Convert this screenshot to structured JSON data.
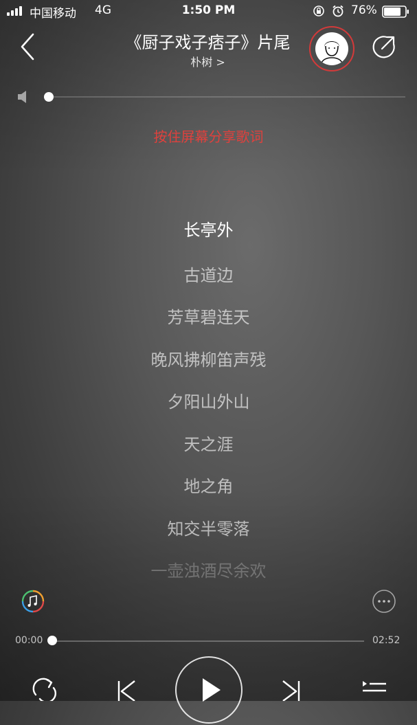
{
  "status_bar": {
    "carrier": "中国移动",
    "network": "4G",
    "time": "1:50 PM",
    "battery_pct": "76%"
  },
  "header": {
    "title": "《厨子戏子痞子》片尾",
    "artist": "朴树 >"
  },
  "volume": {
    "level": 0.0
  },
  "share_hint": "按住屏幕分享歌词",
  "lyrics": {
    "current_index": 0,
    "lines": [
      "长亭外",
      "古道边",
      "芳草碧连天",
      "晚风拂柳笛声残",
      "夕阳山外山",
      "天之涯",
      "地之角",
      "知交半零落",
      "一壶浊酒尽余欢"
    ]
  },
  "player": {
    "elapsed": "00:00",
    "duration": "02:52",
    "progress": 0.0
  },
  "colors": {
    "accent": "#e0413d",
    "avatar_ring": "#d23a3a"
  },
  "icons": {
    "back": "chevron-left-icon",
    "share": "share-arrow-icon",
    "volume": "speaker-icon",
    "music": "music-note-icon",
    "more": "more-dots-icon",
    "repeat": "repeat-icon",
    "prev": "skip-previous-icon",
    "play": "play-icon",
    "next": "skip-next-icon",
    "playlist": "playlist-icon"
  }
}
